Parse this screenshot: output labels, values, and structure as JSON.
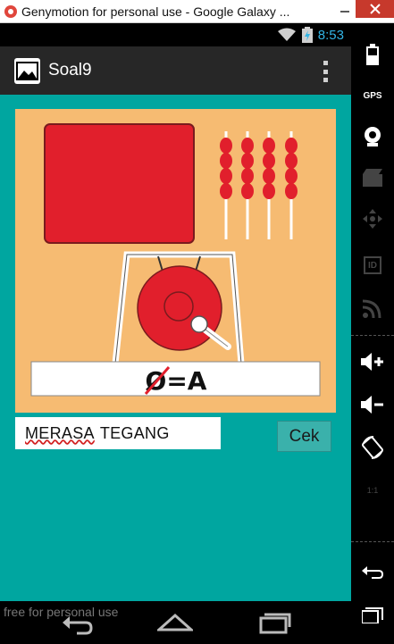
{
  "window": {
    "title": "Genymotion for personal use - Google Galaxy ..."
  },
  "status_bar": {
    "time": "8:53",
    "time_color": "#33b5e5"
  },
  "action_bar": {
    "title": "Soal9",
    "icons": [
      "gallery-icon",
      "overflow-menu-icon"
    ]
  },
  "puzzle": {
    "rebus_text": "Ø=A",
    "colors": {
      "background": "#f6bb72",
      "red": "#e11f2c",
      "frame": "#ffffff"
    }
  },
  "answer": {
    "value_part1": "MERASA",
    "value_part2": "TEGANG"
  },
  "check_button": {
    "label": "Cek"
  },
  "watermark": "free for personal use",
  "toolbar": {
    "items": [
      "battery-icon",
      "gps-icon",
      "webcam-icon",
      "capture-icon",
      "dpad-icon",
      "id-icon",
      "rss-icon",
      "volume-up-icon",
      "volume-down-icon",
      "rotate-icon",
      "scale-icon",
      "back-icon",
      "menu-icon"
    ],
    "gps_label": "GPS",
    "id_label": "ID",
    "scale_label": "1:1"
  },
  "theme": {
    "content_bg": "#00a6a0",
    "action_bar_bg": "#272727"
  }
}
